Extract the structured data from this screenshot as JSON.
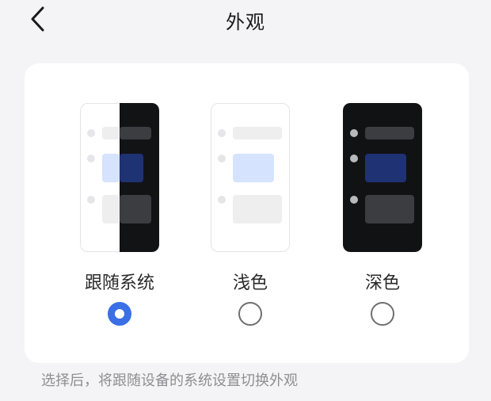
{
  "header": {
    "title": "外观",
    "back_icon": "chevron-left-icon"
  },
  "appearance_options": [
    {
      "label": "跟随系统",
      "selected": true,
      "preview": "split light/dark"
    },
    {
      "label": "浅色",
      "selected": false,
      "preview": "light"
    },
    {
      "label": "深色",
      "selected": false,
      "preview": "dark"
    }
  ],
  "footer_note": "选择后，将跟随设备的系统设置切换外观",
  "colors": {
    "accent": "#3a6fe6",
    "background": "#f4f4f6",
    "card": "#ffffff",
    "dark_preview": "#111214",
    "light_highlight": "#d6e3ff",
    "dark_highlight": "#1f3273"
  }
}
